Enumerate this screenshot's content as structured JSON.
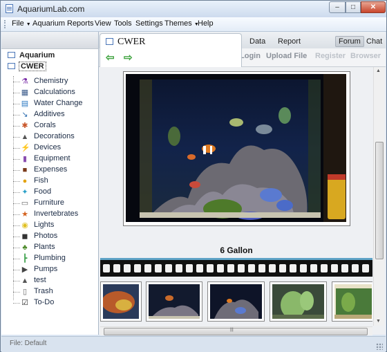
{
  "window": {
    "title": "AquariumLab.com",
    "min_label": "–",
    "max_label": "□",
    "close_label": "✕"
  },
  "menu": [
    {
      "label": "File",
      "dropdown": true
    },
    {
      "label": "Aquarium"
    },
    {
      "label": "Reports"
    },
    {
      "label": "View"
    },
    {
      "label": "Tools"
    },
    {
      "label": "Settings"
    },
    {
      "label": "Themes",
      "dropdown": true
    },
    {
      "label": "Help"
    }
  ],
  "tree": {
    "roots": [
      {
        "label": "Aquarium"
      },
      {
        "label": "CWER",
        "selected": true
      }
    ],
    "items": [
      {
        "label": "Chemistry",
        "icon": "flask-icon",
        "glyph": "⚗",
        "color": "#7b2fa8"
      },
      {
        "label": "Calculations",
        "icon": "calculator-icon",
        "glyph": "▦",
        "color": "#3a5a8a"
      },
      {
        "label": "Water Change",
        "icon": "water-icon",
        "glyph": "▤",
        "color": "#2b78c2"
      },
      {
        "label": "Additives",
        "icon": "dropper-icon",
        "glyph": "↘",
        "color": "#2f6fb0"
      },
      {
        "label": "Corals",
        "icon": "coral-icon",
        "glyph": "✱",
        "color": "#c8562a"
      },
      {
        "label": "Decorations",
        "icon": "rock-icon",
        "glyph": "▲",
        "color": "#555555"
      },
      {
        "label": "Devices",
        "icon": "lightning-icon",
        "glyph": "⚡",
        "color": "#d99a12"
      },
      {
        "label": "Equipment",
        "icon": "equipment-icon",
        "glyph": "▮",
        "color": "#8a4fb0"
      },
      {
        "label": "Expenses",
        "icon": "wallet-icon",
        "glyph": "■",
        "color": "#7a3a1a"
      },
      {
        "label": "Fish",
        "icon": "fish-icon",
        "glyph": "●",
        "color": "#e3a312"
      },
      {
        "label": "Food",
        "icon": "food-icon",
        "glyph": "✦",
        "color": "#2aa0c8"
      },
      {
        "label": "Furniture",
        "icon": "furniture-icon",
        "glyph": "▭",
        "color": "#666666"
      },
      {
        "label": "Invertebrates",
        "icon": "starfish-icon",
        "glyph": "★",
        "color": "#d4621e"
      },
      {
        "label": "Lights",
        "icon": "bulb-icon",
        "glyph": "◉",
        "color": "#e0c020"
      },
      {
        "label": "Photos",
        "icon": "camera-icon",
        "glyph": "◼",
        "color": "#333333"
      },
      {
        "label": "Plants",
        "icon": "plant-icon",
        "glyph": "♣",
        "color": "#4c8a2a"
      },
      {
        "label": "Plumbing",
        "icon": "pipe-icon",
        "glyph": "┣",
        "color": "#3aa04a"
      },
      {
        "label": "Pumps",
        "icon": "pump-icon",
        "glyph": "▶",
        "color": "#444444"
      },
      {
        "label": "test",
        "icon": "rock-icon",
        "glyph": "▲",
        "color": "#555555"
      },
      {
        "label": "Trash",
        "icon": "trash-icon",
        "glyph": "▯",
        "color": "#666666"
      },
      {
        "label": "To-Do",
        "icon": "checklist-icon",
        "glyph": "☑",
        "color": "#333333"
      }
    ]
  },
  "right": {
    "tab_title": "CWER",
    "back_icon": "⇦",
    "forward_icon": "⇨",
    "tabs": [
      {
        "label": "Data"
      },
      {
        "label": "Report"
      },
      {
        "label": "Forum",
        "active": true
      },
      {
        "label": "Chat"
      }
    ],
    "links": [
      {
        "label": "Login",
        "enabled": true
      },
      {
        "label": "Upload File",
        "enabled": true
      },
      {
        "label": "Register",
        "enabled": false
      },
      {
        "label": "Browser",
        "enabled": false
      }
    ],
    "photo_caption": "6 Gallon",
    "thumbnail_count": 5
  },
  "status": {
    "text": "File: Default"
  },
  "colors": {
    "accent": "#4a76b8",
    "link_enabled": "#8a9099",
    "link_disabled": "#bcc1c8",
    "film_line": "#5ea3c6"
  }
}
